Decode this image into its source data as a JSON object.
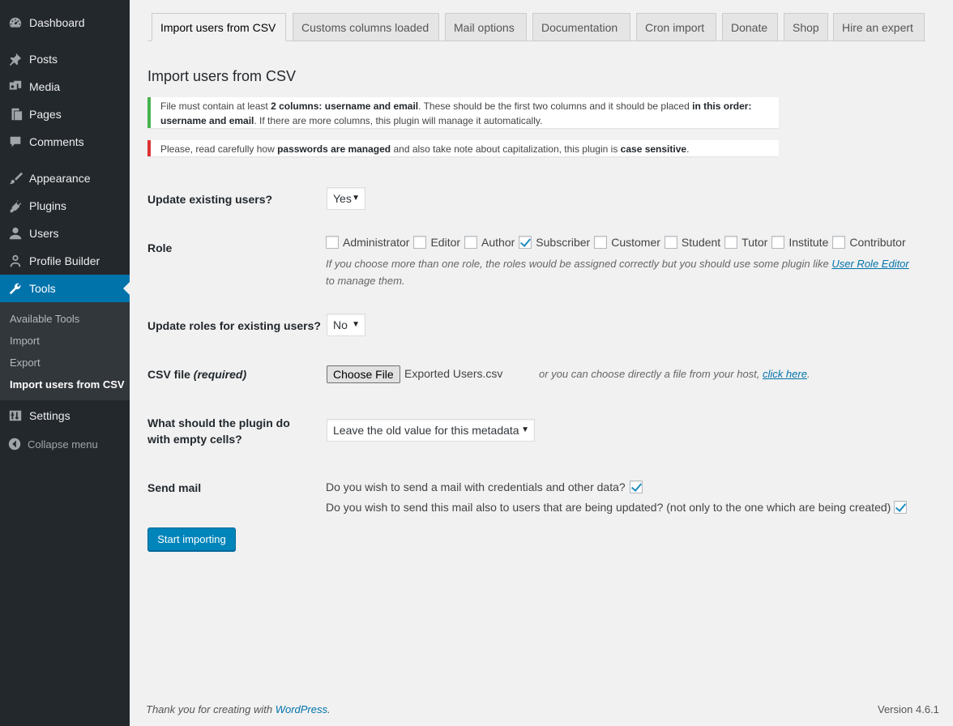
{
  "sidebar": {
    "items": [
      {
        "label": "Dashboard",
        "icon": "dashboard-icon"
      },
      {
        "label": "Posts",
        "icon": "pin-icon"
      },
      {
        "label": "Media",
        "icon": "media-icon"
      },
      {
        "label": "Pages",
        "icon": "pages-icon"
      },
      {
        "label": "Comments",
        "icon": "comments-icon"
      },
      {
        "label": "Appearance",
        "icon": "brush-icon"
      },
      {
        "label": "Plugins",
        "icon": "plugin-icon"
      },
      {
        "label": "Users",
        "icon": "users-icon"
      },
      {
        "label": "Profile Builder",
        "icon": "person-icon"
      },
      {
        "label": "Tools",
        "icon": "wrench-icon"
      },
      {
        "label": "Settings",
        "icon": "settings-icon"
      }
    ],
    "submenu": [
      "Available Tools",
      "Import",
      "Export",
      "Import users from CSV"
    ],
    "collapse_label": "Collapse menu"
  },
  "tabs": [
    "Import users from CSV",
    "Customs columns loaded",
    "Mail options",
    "Documentation",
    "Cron import",
    "Donate",
    "Shop",
    "Hire an expert"
  ],
  "page_title": "Import users from CSV",
  "notices": {
    "success": {
      "p1": "File must contain at least ",
      "b1": "2 columns: username and email",
      "p2": ". These should be the first two columns and it should be placed ",
      "b2": "in this order: username and email",
      "p3": ". If there are more columns, this plugin will manage it automatically."
    },
    "error": {
      "p1": "Please, read carefully how ",
      "b1": "passwords are managed",
      "p2": " and also take note about capitalization, this plugin is ",
      "b2": "case sensitive",
      "p3": "."
    }
  },
  "form": {
    "update_existing": {
      "label": "Update existing users?",
      "value": "Yes"
    },
    "role": {
      "label": "Role",
      "options": [
        {
          "name": "Administrator",
          "checked": false
        },
        {
          "name": "Editor",
          "checked": false
        },
        {
          "name": "Author",
          "checked": false
        },
        {
          "name": "Subscriber",
          "checked": true
        },
        {
          "name": "Customer",
          "checked": false
        },
        {
          "name": "Student",
          "checked": false
        },
        {
          "name": "Tutor",
          "checked": false
        },
        {
          "name": "Institute",
          "checked": false
        },
        {
          "name": "Contributor",
          "checked": false
        }
      ],
      "desc_prefix": "If you choose more than one role, the roles would be assigned correctly but you should use some plugin like ",
      "desc_link": "User Role Editor",
      "desc_suffix": " to manage them."
    },
    "update_roles": {
      "label": "Update roles for existing users?",
      "value": "No"
    },
    "csv": {
      "label": "CSV file ",
      "required": "(required)",
      "button": "Choose File",
      "filename": "Exported Users.csv",
      "host_text": "or you can choose directly a file from your host, ",
      "host_link": "click here",
      "host_end": "."
    },
    "empty_cells": {
      "label_line1": "What should the plugin do",
      "label_line2": "with empty cells?",
      "value": "Leave the old value for this metadata"
    },
    "send_mail": {
      "label": "Send mail",
      "q1": "Do you wish to send a mail with credentials and other data?",
      "q1_checked": true,
      "q2": "Do you wish to send this mail also to users that are being updated? (not only to the one which are being created)",
      "q2_checked": true
    },
    "submit": "Start importing"
  },
  "footer": {
    "thanks": "Thank you for creating with ",
    "wp_link": "WordPress",
    "end": ".",
    "version": "Version 4.6.1"
  },
  "colors": {
    "sidebar": "#23282d",
    "active": "#0073aa",
    "primary": "#0085ba",
    "success": "#46b450",
    "error": "#dc3232"
  }
}
